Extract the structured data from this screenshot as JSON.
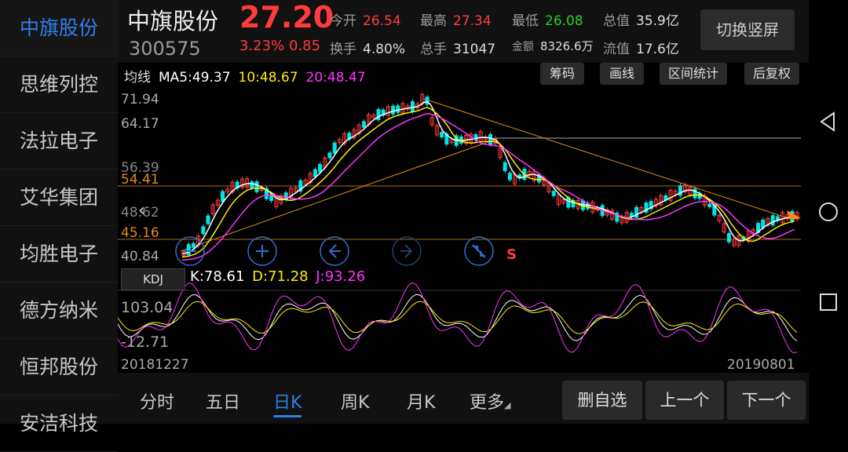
{
  "sidebar": {
    "items": [
      {
        "label": "中旗股份",
        "active": true
      },
      {
        "label": "思维列控",
        "active": false
      },
      {
        "label": "法拉电子",
        "active": false
      },
      {
        "label": "艾华集团",
        "active": false
      },
      {
        "label": "均胜电子",
        "active": false
      },
      {
        "label": "德方纳米",
        "active": false
      },
      {
        "label": "恒邦股份",
        "active": false
      },
      {
        "label": "安洁科技",
        "active": false
      }
    ]
  },
  "header": {
    "name": "中旗股份",
    "code": "300575",
    "price": "27.20",
    "change_pct": "3.23%",
    "change": "0.85",
    "stats": {
      "open_label": "今开",
      "open": "26.54",
      "high_label": "最高",
      "high": "27.34",
      "low_label": "最低",
      "low": "26.08",
      "mktcap_label": "总值",
      "mktcap": "35.9亿",
      "turnover_label": "换手",
      "turnover": "4.80%",
      "volume_label": "总手",
      "volume": "31047",
      "amount_label": "金额",
      "amount": "8326.6万",
      "float_label": "流值",
      "float": "17.6亿"
    },
    "rotate_label": "切换竖屏"
  },
  "chart": {
    "ma_label": "均线",
    "ma5": "MA5:49.37",
    "ma10": "10:48.67",
    "ma20": "20:48.47",
    "tools": [
      "筹码",
      "画线",
      "区间统计",
      "后复权"
    ],
    "y_labels": [
      "71.94",
      "64.17",
      "56.39",
      "54.41",
      "48.62",
      "45.16",
      "40.84"
    ],
    "marker_s": "S",
    "kdj_label": "KDJ",
    "kdj_k": "K:78.61",
    "kdj_d": "D:71.28",
    "kdj_j": "J:93.26",
    "kdj_y_top": "103.04",
    "kdj_y_bottom": "-12.71",
    "date_start": "20181227",
    "date_end": "20190801",
    "colors": {
      "ma5": "#ffffff",
      "ma10": "#ffee00",
      "ma20": "#ff33ff",
      "up": "#ff3b3b",
      "down": "#00e5e5"
    }
  },
  "tabs": {
    "items": [
      "分时",
      "五日",
      "日K",
      "周K",
      "月K",
      "更多"
    ],
    "active_index": 2
  },
  "actions": {
    "remove": "删自选",
    "prev": "上一个",
    "next": "下一个"
  },
  "nav_icons": [
    "back-icon",
    "home-icon",
    "recents-icon"
  ]
}
